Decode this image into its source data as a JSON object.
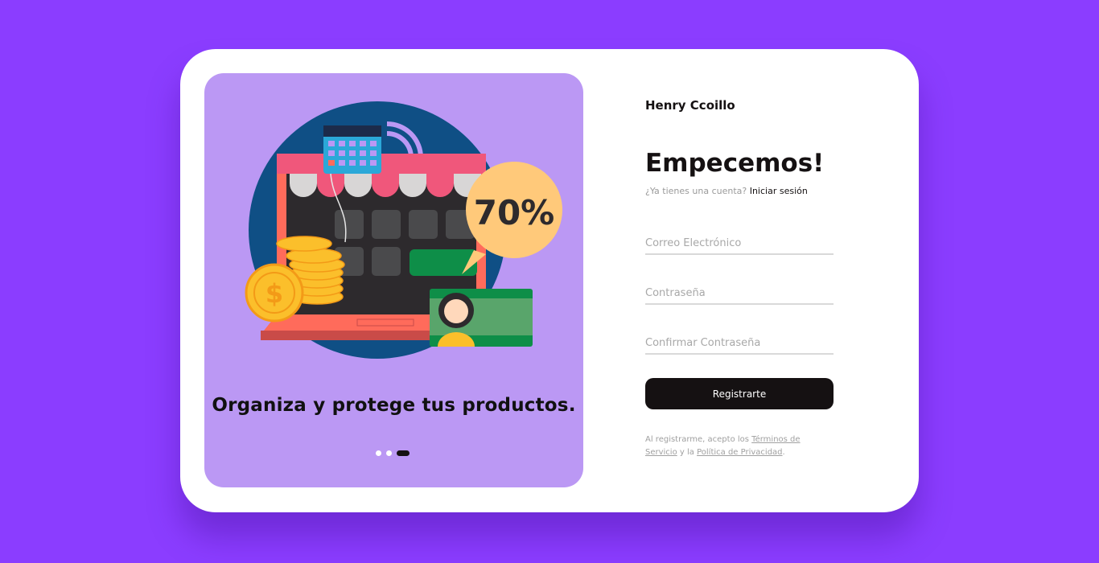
{
  "carousel": {
    "caption": "Organiza y protege tus productos.",
    "discount_badge": "70%",
    "coin_symbol": "$",
    "slides_total": 3,
    "active_slide": 3
  },
  "signup": {
    "brand": "Henry Ccoillo",
    "heading": "Empecemos!",
    "have_account_text": "¿Ya tienes una cuenta?",
    "login_link": "Iniciar sesión",
    "email_placeholder": "Correo Electrónico",
    "password_placeholder": "Contraseña",
    "confirm_placeholder": "Confirmar Contraseña",
    "submit_label": "Registrarte",
    "terms_prefix": "Al registrarme, acepto los",
    "terms_link": "Términos de Servicio",
    "terms_middle": "y la",
    "privacy_link": "Política de Privacidad",
    "terms_suffix": "."
  },
  "colors": {
    "background": "#8b3dff",
    "card": "#ffffff",
    "panel": "#bb98f4",
    "button": "#151112"
  }
}
